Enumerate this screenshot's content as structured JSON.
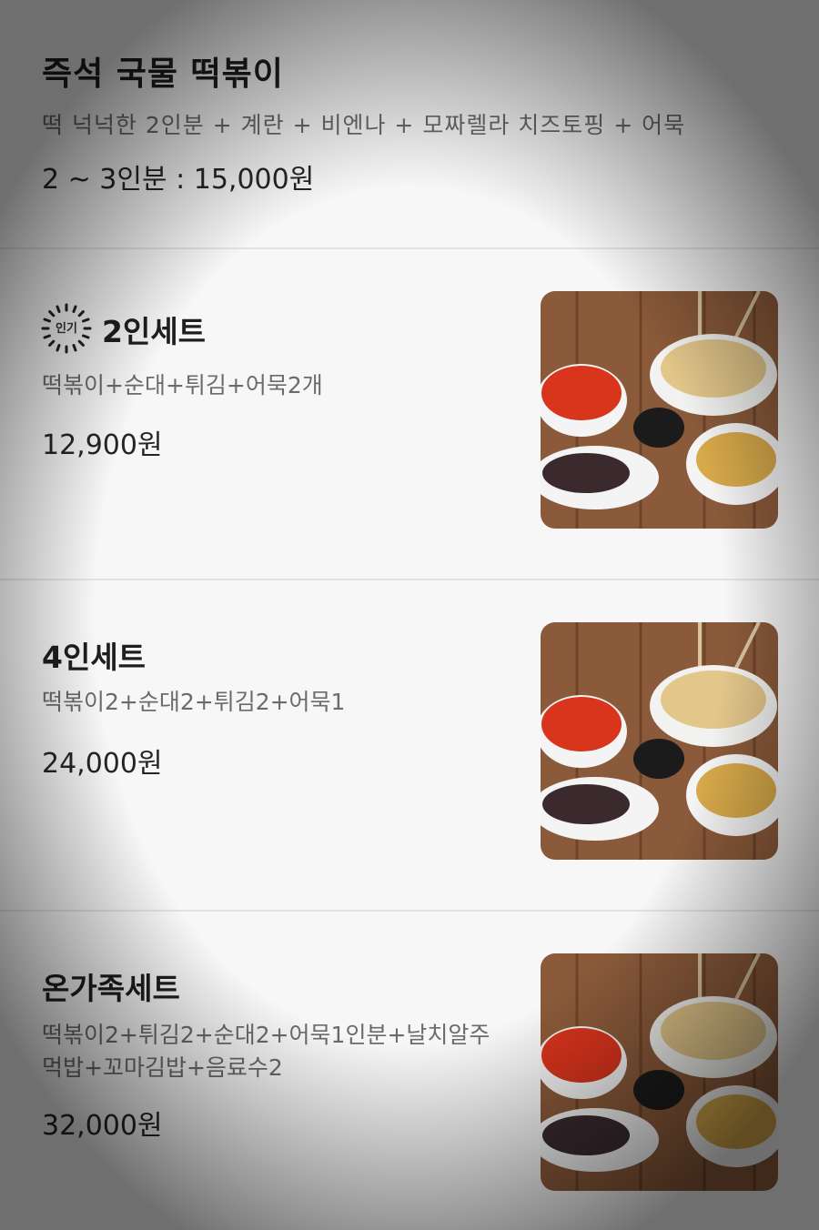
{
  "top": {
    "title": "즉석 국물 떡볶이",
    "desc": "떡 넉넉한 2인분 + 계란 + 비엔나 + 모짜렐라 치즈토핑 + 어묵",
    "price": "2 ~ 3인분 : 15,000원"
  },
  "items": [
    {
      "badge": "인기",
      "name": "2인세트",
      "desc": "떡볶이+순대+튀김+어묵2개",
      "price": "12,900원"
    },
    {
      "name": "4인세트",
      "desc": "떡볶이2+순대2+튀김2+어묵1",
      "price": "24,000원"
    },
    {
      "name": "온가족세트",
      "desc_line1": "떡볶이2+튀김2+순대2+어묵1인분+날치알주",
      "desc_line2": "먹밥+꼬마김밥+음료수2",
      "price": "32,000원"
    }
  ],
  "photo_icon": "food-set-photo"
}
